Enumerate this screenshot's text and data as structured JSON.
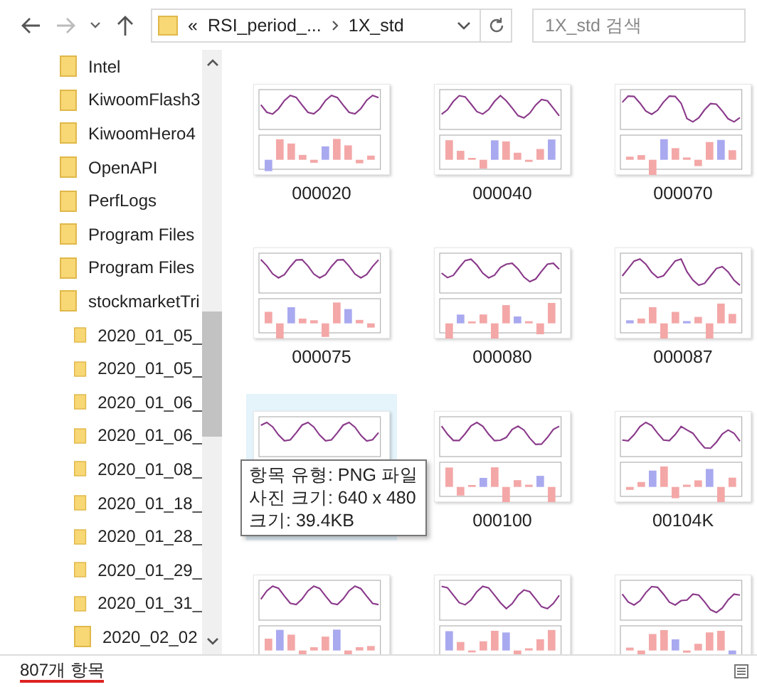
{
  "toolbar": {
    "address": {
      "overflow": "«",
      "segments": [
        "RSI_period_...",
        "1X_std"
      ]
    },
    "search": {
      "placeholder": "1X_std 검색"
    }
  },
  "navigation": {
    "items": [
      {
        "name": "Intel"
      },
      {
        "name": "KiwoomFlash3"
      },
      {
        "name": "KiwoomHero4"
      },
      {
        "name": "OpenAPI"
      },
      {
        "name": "PerfLogs"
      },
      {
        "name": "Program Files"
      },
      {
        "name": "Program Files"
      },
      {
        "name": "stockmarketTri",
        "children": [
          {
            "name": "2020_01_05_"
          },
          {
            "name": "2020_01_05_"
          },
          {
            "name": "2020_01_06_"
          },
          {
            "name": "2020_01_06_"
          },
          {
            "name": "2020_01_08_"
          },
          {
            "name": "2020_01_18_"
          },
          {
            "name": "2020_01_28_"
          },
          {
            "name": "2020_01_29_"
          },
          {
            "name": "2020_01_31_"
          },
          {
            "name": "2020_02_02"
          }
        ]
      }
    ]
  },
  "files": [
    {
      "name": "000020",
      "hovered": false
    },
    {
      "name": "000040",
      "hovered": false
    },
    {
      "name": "000070",
      "hovered": false
    },
    {
      "name": "000075",
      "hovered": false
    },
    {
      "name": "000080",
      "hovered": false
    },
    {
      "name": "000087",
      "hovered": false
    },
    {
      "hovered": true
    },
    {
      "name": "000100",
      "hovered": false
    },
    {
      "name": "00104K",
      "hovered": false
    },
    {
      "hovered": false
    },
    {
      "hovered": false
    },
    {
      "hovered": false
    }
  ],
  "tooltip": {
    "lines": [
      "항목 유형: PNG 파일",
      "사진 크기: 640 x 480",
      "크기: 39.4KB"
    ]
  },
  "status_bar": {
    "count": "807개 항목"
  }
}
